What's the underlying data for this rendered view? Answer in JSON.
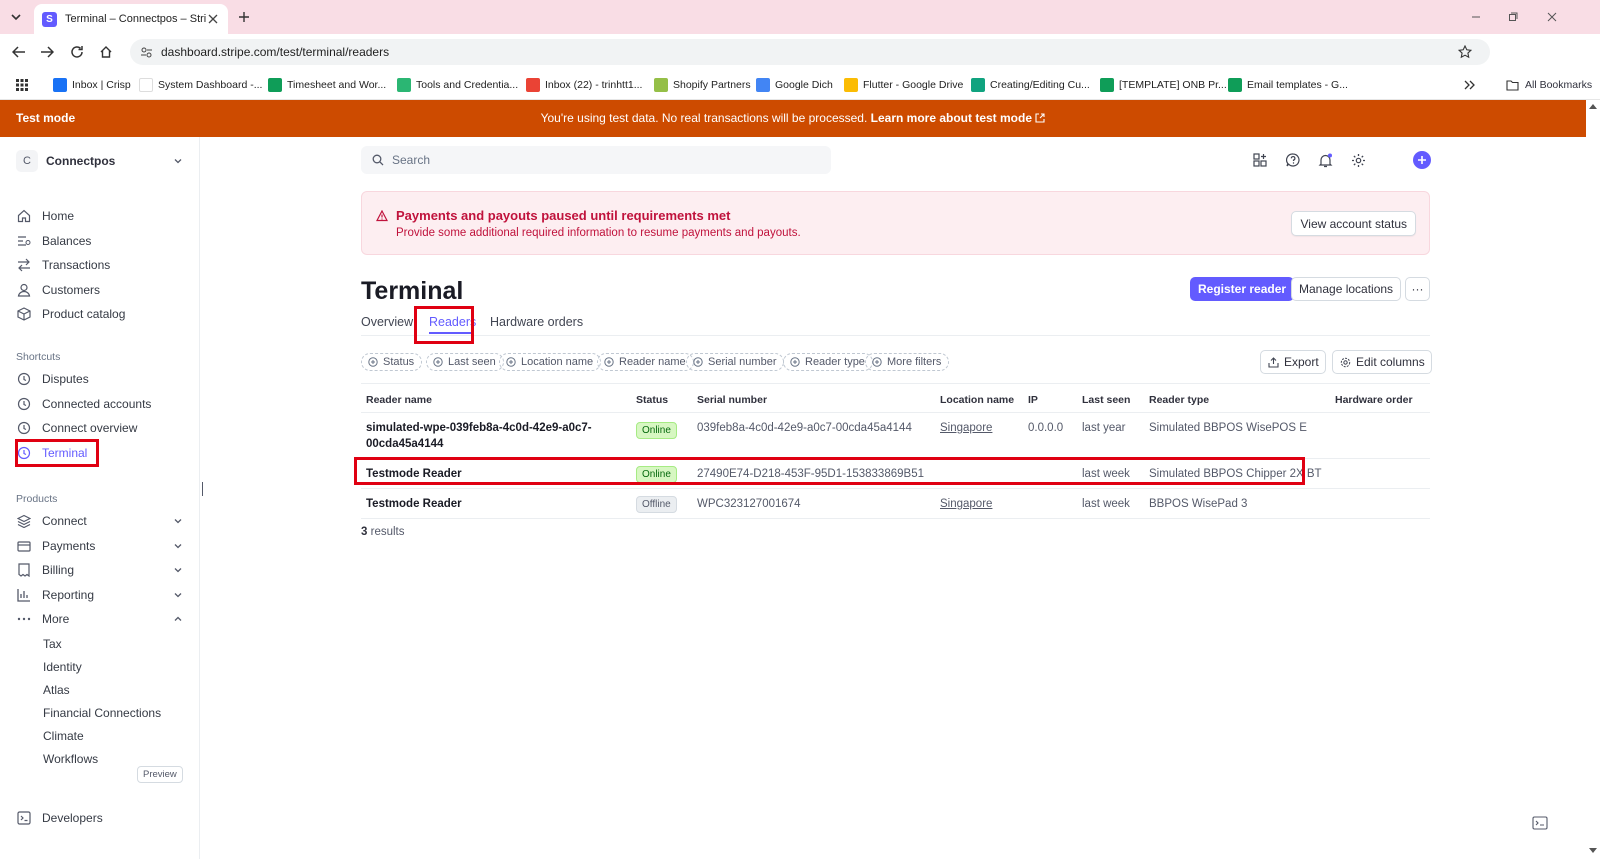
{
  "browser": {
    "tab_title": "Terminal – Connectpos – Stripe",
    "favicon_letter": "S",
    "url": "dashboard.stripe.com/test/terminal/readers",
    "bookmarks": [
      {
        "label": "Inbox | Crisp",
        "color": "#1972f5"
      },
      {
        "label": "System Dashboard -...",
        "color": "#ffffff"
      },
      {
        "label": "Timesheet and Wor...",
        "color": "#0f9d58"
      },
      {
        "label": "Tools and Credentia...",
        "color": "#2bb673"
      },
      {
        "label": "Inbox (22) - trinhtt1...",
        "color": "#ea4335"
      },
      {
        "label": "Shopify Partners",
        "color": "#95bf47"
      },
      {
        "label": "Google Dich",
        "color": "#4285f4"
      },
      {
        "label": "Flutter - Google Drive",
        "color": "#fbbc04"
      },
      {
        "label": "Creating/Editing Cu...",
        "color": "#10a37f"
      },
      {
        "label": "[TEMPLATE] ONB Pr...",
        "color": "#0f9d58"
      },
      {
        "label": "Email templates - G...",
        "color": "#0f9d58"
      }
    ],
    "all_bookmarks": "All Bookmarks"
  },
  "testbar": {
    "label": "Test mode",
    "message": "You're using test data. No real transactions will be processed.",
    "link": "Learn more about test mode"
  },
  "sidebar": {
    "account_initial": "C",
    "account_name": "Connectpos",
    "main_items": [
      {
        "label": "Home",
        "icon": "home-icon"
      },
      {
        "label": "Balances",
        "icon": "balances-icon"
      },
      {
        "label": "Transactions",
        "icon": "transactions-icon"
      },
      {
        "label": "Customers",
        "icon": "customers-icon"
      },
      {
        "label": "Product catalog",
        "icon": "product-catalog-icon"
      }
    ],
    "shortcuts_label": "Shortcuts",
    "shortcuts": [
      "Disputes",
      "Connected accounts",
      "Connect overview",
      "Terminal"
    ],
    "products_label": "Products",
    "products": [
      "Connect",
      "Payments",
      "Billing",
      "Reporting",
      "More"
    ],
    "more_items": [
      "Tax",
      "Identity",
      "Atlas",
      "Financial Connections",
      "Climate",
      "Workflows"
    ],
    "preview_badge": "Preview",
    "developers": "Developers"
  },
  "search": {
    "placeholder": "Search"
  },
  "alert": {
    "title": "Payments and payouts paused until requirements met",
    "description": "Provide some additional required information to resume payments and payouts.",
    "button": "View account status"
  },
  "page": {
    "title": "Terminal",
    "register_button": "Register reader",
    "manage_locations_button": "Manage locations",
    "more_button": "···",
    "tabs": [
      "Overview",
      "Readers",
      "Hardware orders"
    ],
    "active_tab": "Readers"
  },
  "filters": [
    "Status",
    "Last seen",
    "Location name",
    "Reader name",
    "Serial number",
    "Reader type",
    "More filters"
  ],
  "export_button": "Export",
  "edit_columns_button": "Edit columns",
  "table": {
    "columns": [
      "Reader name",
      "Status",
      "Serial number",
      "Location name",
      "IP",
      "Last seen",
      "Reader type",
      "Hardware order"
    ],
    "rows": [
      {
        "name_line1": "simulated-wpe-039feb8a-4c0d-42e9-a0c7-",
        "name_line2": "00cda45a4144",
        "status": "Online",
        "serial": "039feb8a-4c0d-42e9-a0c7-00cda45a4144",
        "location": "Singapore",
        "ip": "0.0.0.0",
        "last_seen": "last year",
        "reader_type": "Simulated BBPOS WisePOS E",
        "hardware_order": ""
      },
      {
        "name_line1": "Testmode Reader",
        "name_line2": "",
        "status": "Online",
        "serial": "27490E74-D218-453F-95D1-153833869B51",
        "location": "",
        "ip": "",
        "last_seen": "last week",
        "reader_type": "Simulated BBPOS Chipper 2X BT",
        "hardware_order": ""
      },
      {
        "name_line1": "Testmode Reader",
        "name_line2": "",
        "status": "Offline",
        "serial": "WPC323127001674",
        "location": "Singapore",
        "ip": "",
        "last_seen": "last week",
        "reader_type": "BBPOS WisePad 3",
        "hardware_order": ""
      }
    ],
    "results_count": "3",
    "results_label": "results"
  },
  "colors": {
    "brand": "#635bff",
    "test_mode": "#cd4b00",
    "alert_text": "#c0123c",
    "highlight": "#e00012"
  }
}
